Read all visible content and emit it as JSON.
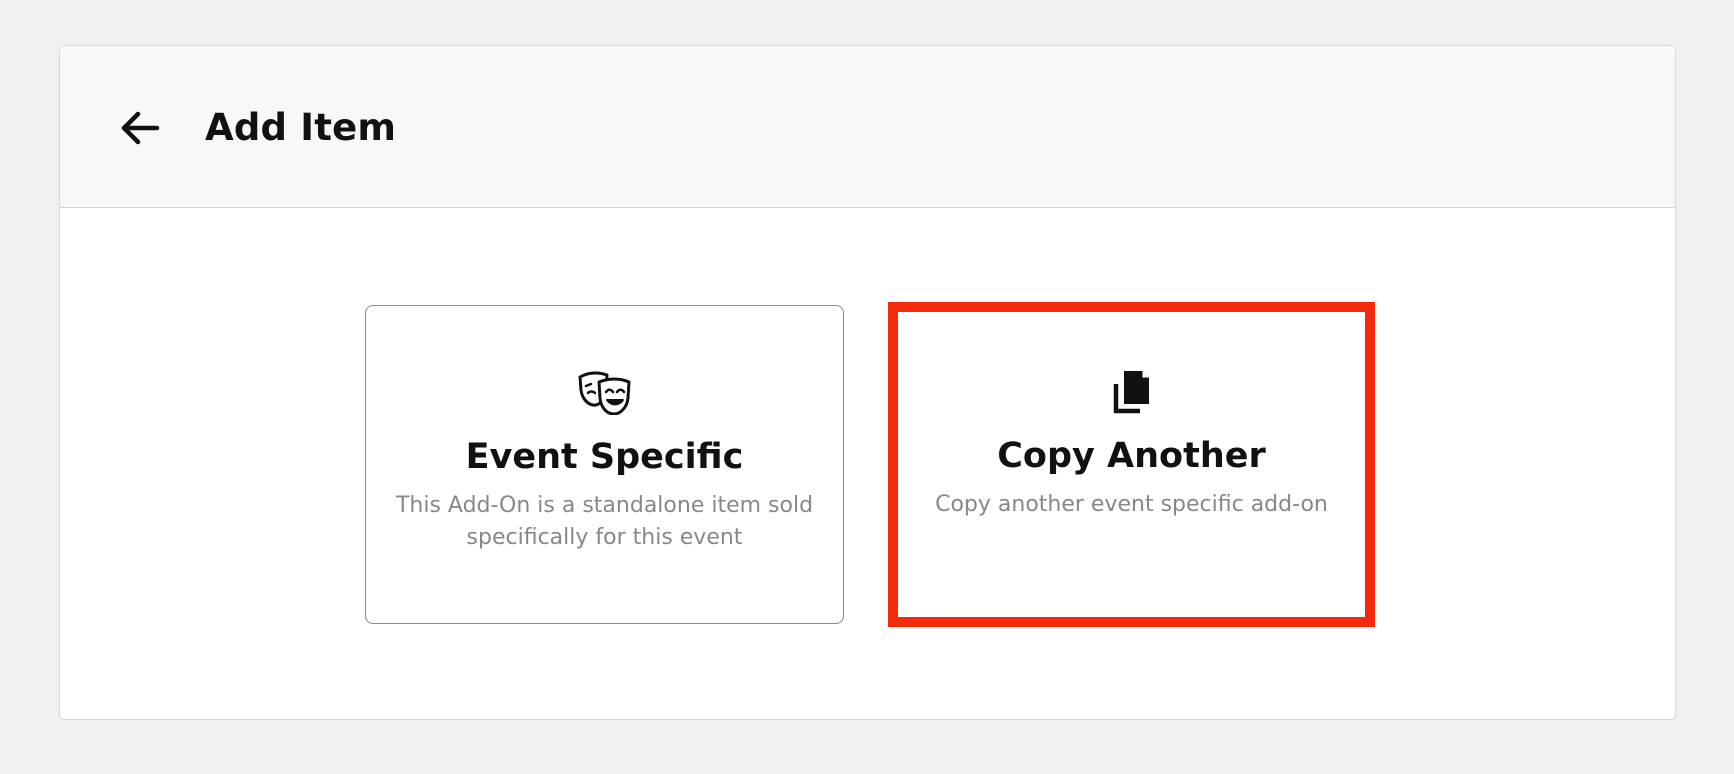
{
  "header": {
    "title": "Add Item",
    "back_icon": "arrow-left-icon"
  },
  "options": [
    {
      "title": "Event Specific",
      "description": "This Add-On is a standalone item sold specifically for this event",
      "icon": "theater-masks-icon"
    },
    {
      "title": "Copy Another",
      "description": "Copy another event specific add-on",
      "icon": "copy-icon"
    }
  ],
  "colors": {
    "highlight_border": "#f42a0c",
    "card_border": "#8b8b8b",
    "header_bg": "#f8f8f8",
    "page_bg": "#f0f0f0",
    "muted_text": "#888888"
  }
}
